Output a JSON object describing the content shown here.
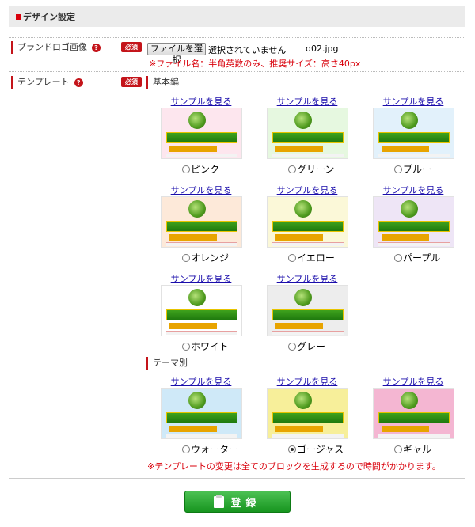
{
  "section": {
    "title": "デザイン設定"
  },
  "brand_logo": {
    "label": "ブランドロゴ画像",
    "help": "?",
    "required": "必須",
    "file_button": "ファイルを選択",
    "file_status": "選択されていません",
    "file_name": "d02.jpg",
    "note": "※ファイル名：半角英数のみ、推奨サイズ：高さ40px"
  },
  "template": {
    "label": "テンプレート",
    "help": "?",
    "required": "必須",
    "basic_group": "基本編",
    "theme_group": "テーマ別",
    "sample_link": "サンプルを見る",
    "note": "※テンプレートの変更は全てのブロックを生成するので時間がかかります。",
    "basic": [
      {
        "name": "ピンク",
        "bg": "#fde6ee",
        "checked": false
      },
      {
        "name": "グリーン",
        "bg": "#e6f8e0",
        "checked": false
      },
      {
        "name": "ブルー",
        "bg": "#e2f1fb",
        "checked": false
      },
      {
        "name": "オレンジ",
        "bg": "#fde9d9",
        "checked": false
      },
      {
        "name": "イエロー",
        "bg": "#fbf8d8",
        "checked": false
      },
      {
        "name": "パープル",
        "bg": "#eee5f6",
        "checked": false
      },
      {
        "name": "ホワイト",
        "bg": "#ffffff",
        "checked": false
      },
      {
        "name": "グレー",
        "bg": "#ededed",
        "checked": false
      }
    ],
    "theme": [
      {
        "name": "ウォーター",
        "bg": "#cfe9f8",
        "checked": false
      },
      {
        "name": "ゴージャス",
        "bg": "#f7ef9a",
        "checked": true
      },
      {
        "name": "ギャル",
        "bg": "#f4b6d2",
        "checked": false
      }
    ]
  },
  "submit": {
    "label": "登録"
  }
}
